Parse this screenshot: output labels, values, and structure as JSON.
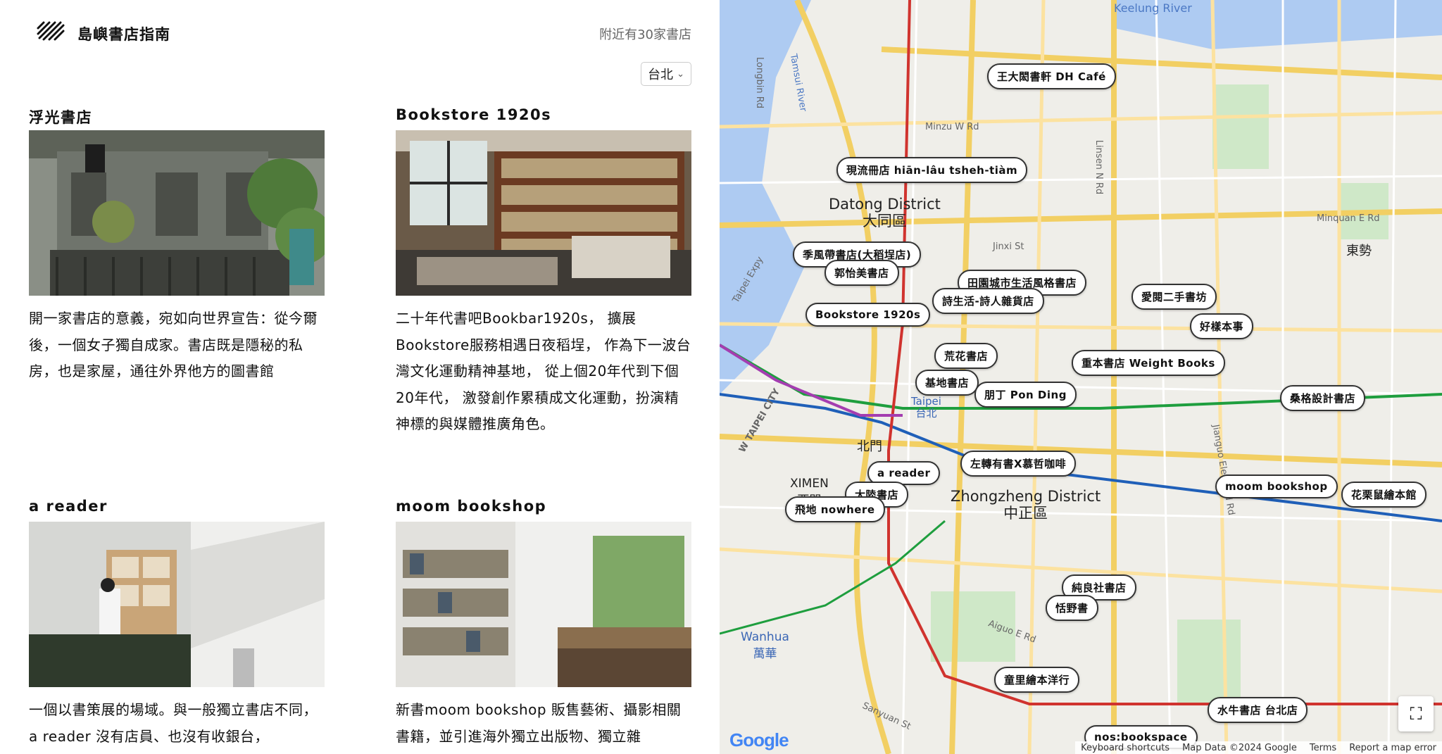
{
  "header": {
    "brand": "島嶼書店指南",
    "nearby": "附近有30家書店",
    "city": "台北"
  },
  "cards": [
    {
      "title": "浮光書店",
      "description": "開一家書店的意義，宛如向世界宣告：從今爾後，一個女子獨自成家。書店既是隱秘的私房，也是家屋，通往外界他方的圖書館"
    },
    {
      "title": "Bookstore 1920s",
      "description": "二十年代書吧Bookbar1920s， 擴展Bookstore服務相遇日夜稻埕， 作為下一波台灣文化運動精神基地， 從上個20年代到下個20年代， 激發創作累積成文化運動，扮演精神標的與媒體推廣角色。"
    },
    {
      "title": "a reader",
      "description": "一個以書策展的場域。與一般獨立書店不同，a reader 沒有店員、也沒有收銀台，"
    },
    {
      "title": "moom bookshop",
      "description": "新書moom bookshop 販售藝術、攝影相關書籍，並引進海外獨立出版物、獨立雜"
    }
  ],
  "map": {
    "pins": [
      "王大閎書軒 DH Café",
      "現流冊店 hiān-lâu tsheh-tiàm",
      "季風帶書店(大稻埕店)",
      "郭怡美書店",
      "田園城市生活風格書店",
      "詩生活-詩人雜貨店",
      "愛閱二手書坊",
      "好樣本事",
      "Bookstore 1920s",
      "荒花書店",
      "重本書店 Weight Books",
      "基地書店",
      "朋丁 Pon Ding",
      "桑格設計書店",
      "左轉有書X慕哲咖啡",
      "a reader",
      "大陸書店",
      "飛地 nowhere",
      "moom bookshop",
      "花栗鼠繪本館",
      "純良社書店",
      "恬野書",
      "童里繪本洋行",
      "水牛書店 台北店",
      "nos:bookspace"
    ],
    "districts": {
      "datong": "Datong District",
      "datong_zh": "大同區",
      "zhongzheng": "Zhongzheng District",
      "zhongzheng_zh": "中正區",
      "ximen": "XIMEN",
      "ximen_zh": "西門",
      "wanhua": "Wanhua",
      "wanhua_zh": "萬華",
      "dongshi": "東勢",
      "beimen": "北門",
      "taipei": "Taipei",
      "taipei_zh": "台北"
    },
    "roads": [
      "Keelung River",
      "Minzu W Rd",
      "Linsen N Rd",
      "Jinxi St",
      "Minquan E Rd",
      "Jianguo Elevated Rd",
      "Aiguo E Rd",
      "Sanyuan St",
      "Longbin Rd",
      "Tamsui River",
      "Taipei Expy",
      "W TAIPEI CITY"
    ],
    "footer": {
      "shortcuts": "Keyboard shortcuts",
      "data": "Map Data ©2024 Google",
      "terms": "Terms",
      "report": "Report a map error"
    },
    "google": "Google"
  }
}
